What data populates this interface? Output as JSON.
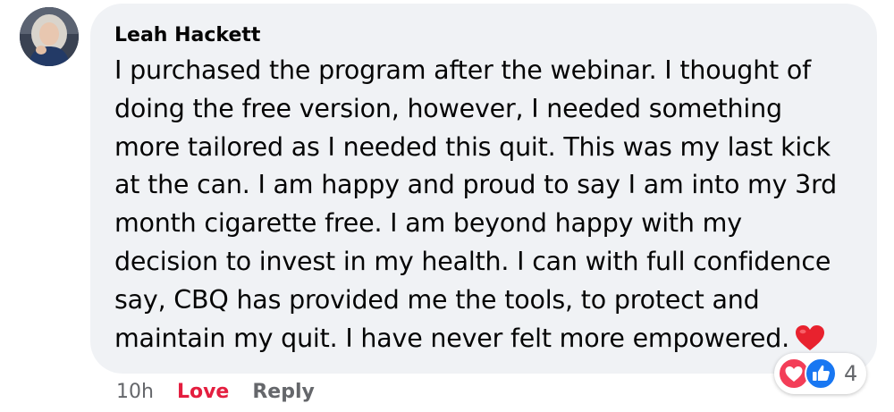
{
  "comment": {
    "author": "Leah Hackett",
    "avatar_icon": "profile-photo-avatar",
    "text": "I purchased the program after the webinar. I thought of\ndoing the free version, however, I needed something\nmore tailored as I needed this quit. This was my last kick\nat the can. I am happy and proud to say I am into my 3rd\nmonth cigarette free. I am beyond happy with my\ndecision to invest in my health. I can with full confidence\nsay, CBQ has provided me the tools, to protect and\nmaintain my quit. I have never felt more empowered.",
    "trailing_emoji": "red-heart-emoji"
  },
  "reactions": {
    "icons": [
      "love-reaction-icon",
      "like-reaction-icon"
    ],
    "count": "4"
  },
  "actions": {
    "time": "10h",
    "love_label": "Love",
    "reply_label": "Reply"
  },
  "colors": {
    "bubble_bg": "#f0f2f5",
    "text": "#050505",
    "muted": "#65676b",
    "love_red": "#e41e3f",
    "like_blue": "#1877f2"
  }
}
